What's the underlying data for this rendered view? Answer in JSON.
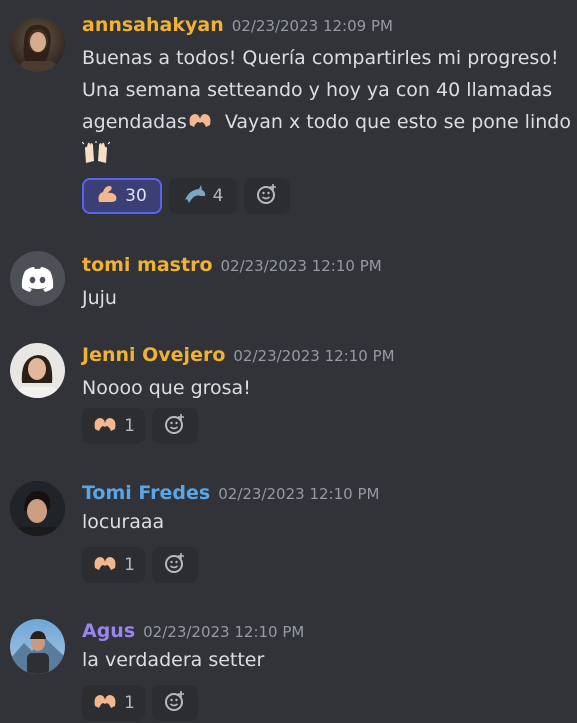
{
  "messages": [
    {
      "author": "annsahakyan",
      "author_color": "#f0b232",
      "timestamp": "02/23/2023 12:09 PM",
      "lines": [
        "Buenas a todos! Quería compartirles mi progreso!",
        "Una semana setteando y hoy ya con  40  llamadas",
        "agendadas",
        "Vayan x todo que esto se pone lindo"
      ],
      "reactions": [
        {
          "icon": "flexed-biceps-icon",
          "count": "30",
          "active": true
        },
        {
          "icon": "dolphin-icon",
          "count": "4",
          "active": false
        }
      ]
    },
    {
      "author": "tomi mastro",
      "author_color": "#f0b232",
      "timestamp": "02/23/2023 12:10 PM",
      "text": "Juju"
    },
    {
      "author": "Jenni Ovejero",
      "author_color": "#f0b232",
      "timestamp": "02/23/2023 12:10 PM",
      "text": "Noooo que grosa!",
      "reactions": [
        {
          "icon": "heart-hands-icon",
          "count": "1"
        }
      ]
    },
    {
      "author": "Tomi Fredes",
      "author_color": "#5aa5e6",
      "timestamp": "02/23/2023 12:10 PM",
      "text": "locuraaa",
      "reactions": [
        {
          "icon": "heart-hands-icon",
          "count": "1"
        }
      ]
    },
    {
      "author": "Agus",
      "author_color": "#9b84ec",
      "timestamp": "02/23/2023 12:10 PM",
      "text": "la verdadera setter",
      "reactions": [
        {
          "icon": "heart-hands-icon",
          "count": "1"
        }
      ]
    }
  ]
}
